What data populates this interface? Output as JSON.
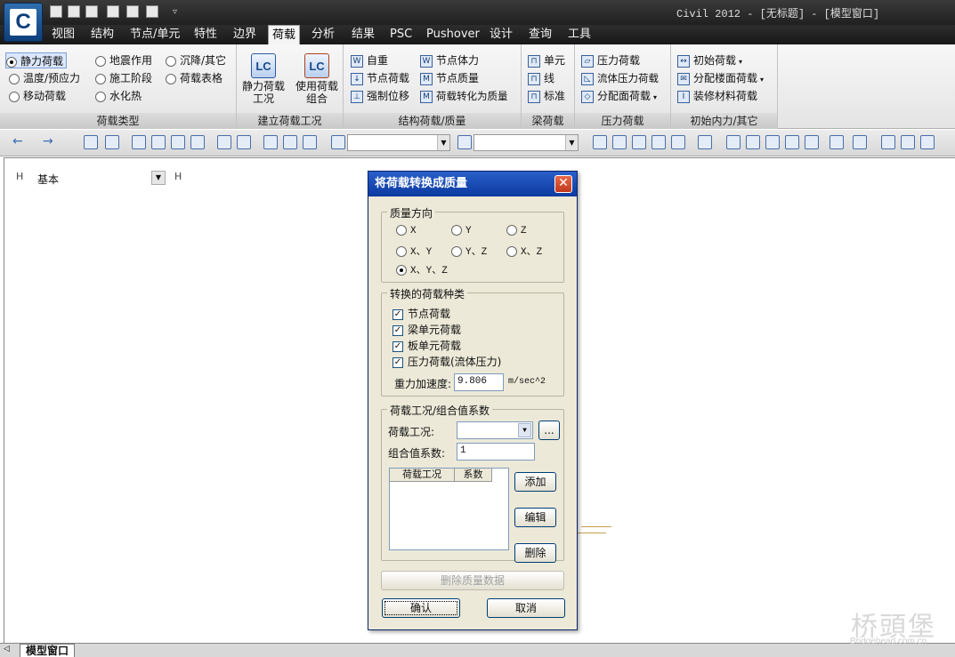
{
  "window": {
    "title": "Civil 2012 - [无标题] - [模型窗口]"
  },
  "tabs": [
    "视图",
    "结构",
    "节点/单元",
    "特性",
    "边界",
    "荷载",
    "分析",
    "结果",
    "PSC",
    "Pushover",
    "设计",
    "查询",
    "工具"
  ],
  "active_tab": "荷载",
  "ribbon": {
    "load_type": {
      "label": "荷载类型",
      "options": [
        "静力荷载",
        "温度/预应力",
        "移动荷载",
        "地震作用",
        "施工阶段",
        "水化热",
        "沉降/其它",
        "荷载表格"
      ],
      "selected": "静力荷载"
    },
    "create_case": {
      "label": "建立荷载工况",
      "btn1": "静力荷载\n工况",
      "btn1_a": "静力荷载",
      "btn1_b": "工况",
      "btn2_a": "使用荷载",
      "btn2_b": "组合",
      "icon1": "LC",
      "icon2": "LC"
    },
    "struct_load": {
      "label": "结构荷载/质量",
      "items": [
        "自重",
        "节点荷载",
        "强制位移",
        "节点体力",
        "节点质量",
        "荷载转化为质量"
      ]
    },
    "beam_load": {
      "label": "梁荷载",
      "items": [
        "单元",
        "线",
        "标准"
      ]
    },
    "pressure_load": {
      "label": "压力荷载",
      "items": [
        "压力荷载",
        "流体压力荷载",
        "分配面荷载"
      ]
    },
    "init_force": {
      "label": "初始内力/其它",
      "items": [
        "初始荷载",
        "分配楼面荷载",
        "装修材料荷载"
      ]
    }
  },
  "tree": {
    "label": "基本"
  },
  "dialog": {
    "title": "将荷载转换成质量",
    "close": "✕",
    "mass_direction": {
      "label": "质量方向",
      "options": [
        "X",
        "Y",
        "Z",
        "X、Y",
        "Y、Z",
        "X、Z",
        "X、Y、Z"
      ],
      "selected": "X、Y、Z"
    },
    "convert_types": {
      "label": "转换的荷载种类",
      "items": [
        "节点荷载",
        "梁单元荷载",
        "板单元荷载",
        "压力荷载(流体压力)"
      ],
      "check": "✓"
    },
    "gravity_label": "重力加速度:",
    "gravity_value": "9.806",
    "gravity_unit": "m/sec^2",
    "case_factor": {
      "label": "荷载工况/组合值系数",
      "case_label": "荷载工况:",
      "case_value": "",
      "more": "...",
      "factor_label": "组合值系数:",
      "factor_value": "1",
      "col1": "荷载工况",
      "col2": "系数",
      "add": "添加",
      "edit": "编辑",
      "delete": "删除"
    },
    "delete_mass": "删除质量数据",
    "ok": "确认",
    "cancel": "取消"
  },
  "bottom": {
    "window_tab": "模型窗口"
  },
  "watermark": {
    "text": "桥頭堡",
    "url": "Bridgehead.com.cn"
  },
  "colors": {
    "dialog_title": "#0b3aa0",
    "dialog_bg": "#ece9d8",
    "title_bar": "#202020"
  }
}
